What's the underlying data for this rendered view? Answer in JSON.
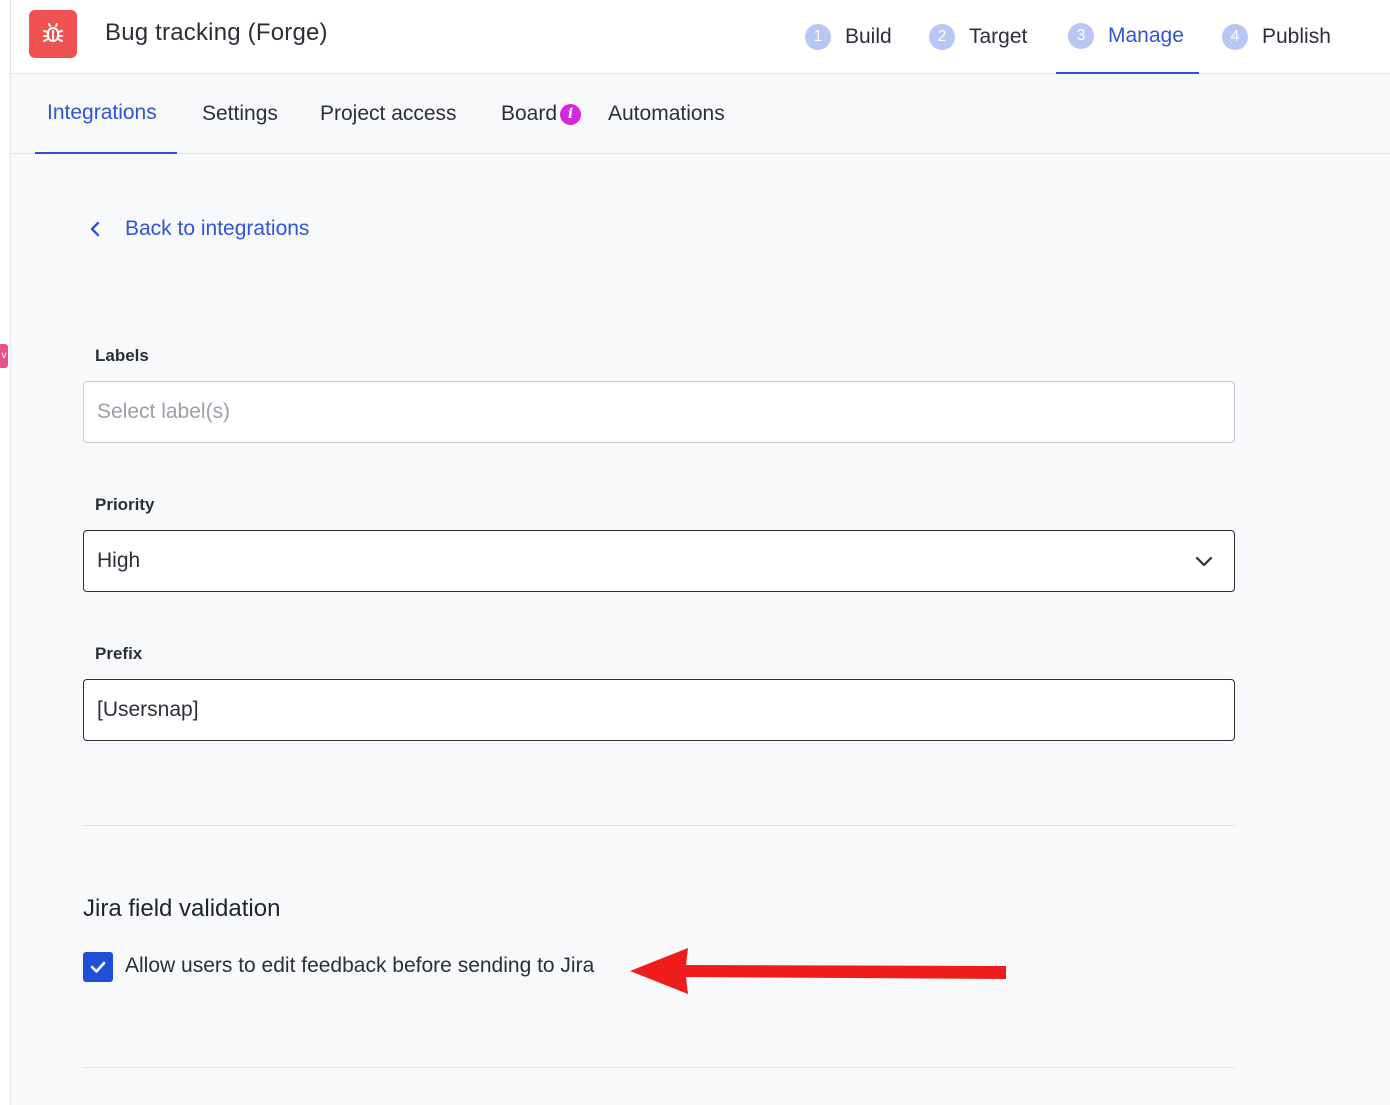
{
  "app": {
    "title": "Bug tracking (Forge)",
    "icon": "bug-icon",
    "icon_color": "#f05252"
  },
  "steps": [
    {
      "number": "1",
      "label": "Build"
    },
    {
      "number": "2",
      "label": "Target"
    },
    {
      "number": "3",
      "label": "Manage",
      "active": true
    },
    {
      "number": "4",
      "label": "Publish"
    }
  ],
  "subnav": {
    "tabs": [
      {
        "label": "Integrations",
        "active": true
      },
      {
        "label": "Settings"
      },
      {
        "label": "Project access"
      },
      {
        "label": "Board",
        "badge": "i"
      },
      {
        "label": "Automations"
      }
    ]
  },
  "back_link": {
    "label": "Back to integrations",
    "icon": "chevron-left-icon"
  },
  "form": {
    "labels": {
      "label": "Labels",
      "placeholder": "Select label(s)",
      "value": ""
    },
    "priority": {
      "label": "Priority",
      "value": "High",
      "icon": "chevron-down-icon"
    },
    "prefix": {
      "label": "Prefix",
      "value": "[Usersnap]"
    }
  },
  "jira_validation": {
    "title": "Jira field validation",
    "checkbox_label": "Allow users to edit feedback before sending to Jira",
    "checked": true
  },
  "colors": {
    "accent": "#2f55d4",
    "checkbox": "#1f4fd6",
    "annotation_arrow": "#ee1c1c",
    "badge": "#d627e0"
  }
}
